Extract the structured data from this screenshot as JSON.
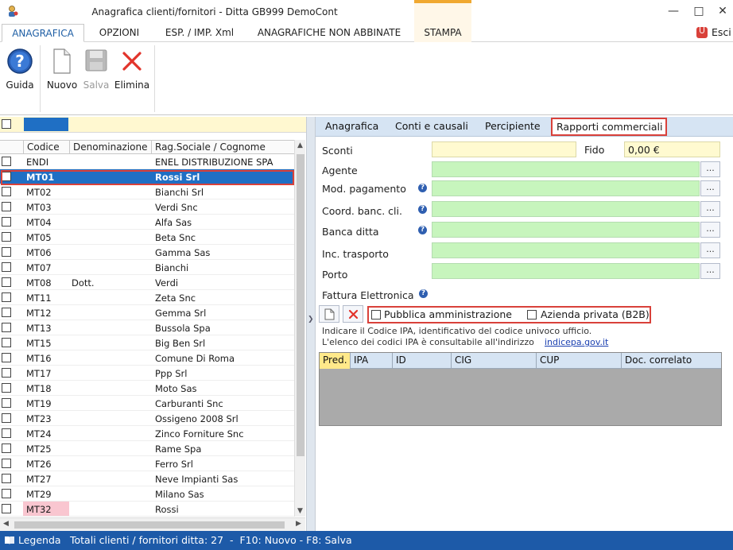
{
  "window": {
    "title": "Anagrafica clienti/fornitori - Ditta GB999 DemoCont"
  },
  "menu": {
    "tabs": [
      "ANAGRAFICA",
      "OPZIONI",
      "ESP. / IMP. Xml",
      "ANAGRAFICHE NON ABBINATE",
      "STAMPA"
    ],
    "exit_label": "Esci"
  },
  "ribbon": {
    "guida": "Guida",
    "nuovo": "Nuovo",
    "salva": "Salva",
    "elimina": "Elimina"
  },
  "grid": {
    "headers": [
      "Codice",
      "Denominazione",
      "Rag.Sociale / Cognome"
    ],
    "rows": [
      {
        "code": "ENDI",
        "den": "",
        "rag": "ENEL DISTRIBUZIONE SPA"
      },
      {
        "code": "MT01",
        "den": "",
        "rag": "Rossi Srl"
      },
      {
        "code": "MT02",
        "den": "",
        "rag": "Bianchi Srl"
      },
      {
        "code": "MT03",
        "den": "",
        "rag": "Verdi Snc"
      },
      {
        "code": "MT04",
        "den": "",
        "rag": "Alfa Sas"
      },
      {
        "code": "MT05",
        "den": "",
        "rag": "Beta Snc"
      },
      {
        "code": "MT06",
        "den": "",
        "rag": "Gamma Sas"
      },
      {
        "code": "MT07",
        "den": "",
        "rag": "Bianchi"
      },
      {
        "code": "MT08",
        "den": "Dott.",
        "rag": "Verdi"
      },
      {
        "code": "MT11",
        "den": "",
        "rag": "Zeta Snc"
      },
      {
        "code": "MT12",
        "den": "",
        "rag": "Gemma Srl"
      },
      {
        "code": "MT13",
        "den": "",
        "rag": "Bussola Spa"
      },
      {
        "code": "MT15",
        "den": "",
        "rag": "Big Ben Srl"
      },
      {
        "code": "MT16",
        "den": "",
        "rag": "Comune Di Roma"
      },
      {
        "code": "MT17",
        "den": "",
        "rag": "Ppp Srl"
      },
      {
        "code": "MT18",
        "den": "",
        "rag": "Moto Sas"
      },
      {
        "code": "MT19",
        "den": "",
        "rag": "Carburanti Snc"
      },
      {
        "code": "MT23",
        "den": "",
        "rag": "Ossigeno 2008 Srl"
      },
      {
        "code": "MT24",
        "den": "",
        "rag": "Zinco Forniture Snc"
      },
      {
        "code": "MT25",
        "den": "",
        "rag": "Rame Spa"
      },
      {
        "code": "MT26",
        "den": "",
        "rag": "Ferro Srl"
      },
      {
        "code": "MT27",
        "den": "",
        "rag": "Neve Impianti Sas"
      },
      {
        "code": "MT29",
        "den": "",
        "rag": "Milano Sas"
      },
      {
        "code": "MT32",
        "den": "",
        "rag": "Rossi"
      }
    ]
  },
  "detail": {
    "tabs": [
      "Anagrafica",
      "Conti e causali",
      "Percipiente",
      "Rapporti commerciali"
    ],
    "labels": {
      "sconti": "Sconti",
      "fido": "Fido",
      "fido_value": "0,00 €",
      "agente": "Agente",
      "mod_pagamento": "Mod. pagamento",
      "coord_banc": "Coord. banc. cli.",
      "banca_ditta": "Banca ditta",
      "inc_trasporto": "Inc. trasporto",
      "porto": "Porto",
      "fattura": "Fattura Elettronica"
    },
    "ellipsis": "...",
    "pa_label": "Pubblica amministrazione",
    "b2b_label": "Azienda privata (B2B)",
    "info_line1": "Indicare il Codice IPA, identificativo del codice univoco ufficio.",
    "info_line2": "L'elenco dei codici IPA è consultabile all'indirizzo",
    "info_link": "indicepa.gov.it",
    "ipa_headers": [
      "Pred.",
      "IPA",
      "ID",
      "CIG",
      "CUP",
      "Doc. correlato"
    ]
  },
  "status": {
    "legenda": "Legenda",
    "text": "Totali clienti / fornitori ditta: 27  -  F10: Nuovo - F8: Salva"
  }
}
